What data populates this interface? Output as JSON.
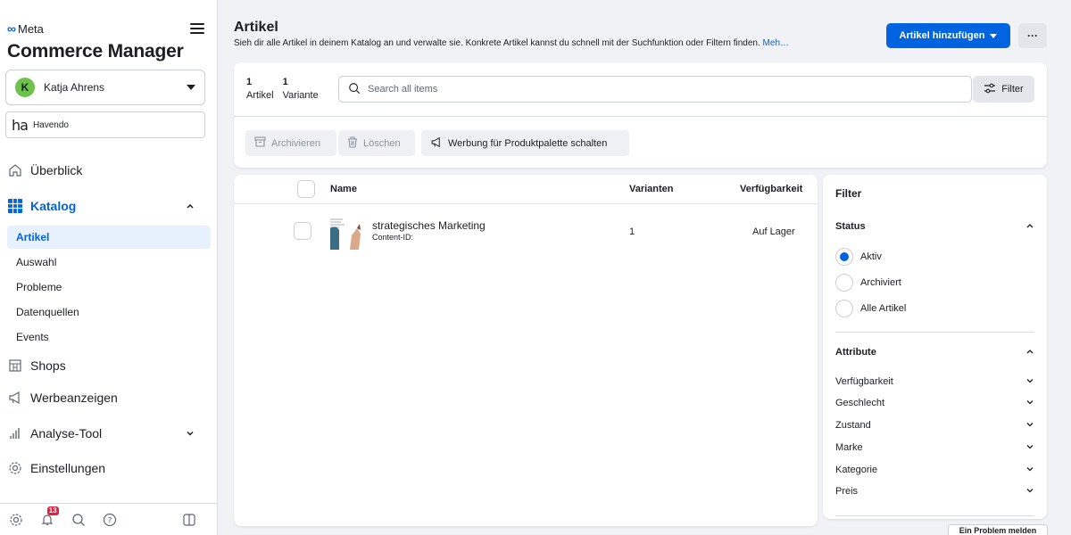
{
  "brand": {
    "meta": "Meta",
    "app_title": "Commerce Manager"
  },
  "account": {
    "initial": "K",
    "name": "Katja Ahrens"
  },
  "catalog": {
    "logo": "ha",
    "name": "Havendo"
  },
  "nav": {
    "overview": "Überblick",
    "catalog": "Katalog",
    "catalog_sub": [
      "Artikel",
      "Auswahl",
      "Probleme",
      "Datenquellen",
      "Events"
    ],
    "shops": "Shops",
    "ads": "Werbeanzeigen",
    "analytics": "Analyse-Tool",
    "settings": "Einstellungen"
  },
  "footer": {
    "notification_count": "13"
  },
  "header": {
    "title": "Artikel",
    "description": "Sieh dir alle Artikel in deinem Katalog an und verwalte sie. Konkrete Artikel kannst du schnell mit der Suchfunktion oder Filtern finden.",
    "more_link": "Meh…",
    "add_button": "Artikel hinzufügen",
    "more_button": "···"
  },
  "toolbar": {
    "items_count": "1",
    "items_label": "Artikel",
    "variants_count": "1",
    "variants_label": "Variante",
    "search_placeholder": "Search all items",
    "filter_button": "Filter",
    "archive_button": "Archivieren",
    "delete_button": "Löschen",
    "advertise_button": "Werbung für Produktpalette schalten"
  },
  "table": {
    "columns": {
      "name": "Name",
      "variants": "Varianten",
      "availability": "Verfügbarkeit"
    },
    "rows": [
      {
        "name": "strategisches Marketing",
        "content_id": "Content-ID:",
        "variants": "1",
        "availability": "Auf Lager"
      }
    ]
  },
  "filter_panel": {
    "title": "Filter",
    "status_title": "Status",
    "status_options": [
      "Aktiv",
      "Archiviert",
      "Alle Artikel"
    ],
    "status_selected": "Aktiv",
    "attributes_title": "Attribute",
    "attributes": [
      "Verfügbarkeit",
      "Geschlecht",
      "Zustand",
      "Marke",
      "Kategorie",
      "Preis"
    ]
  },
  "report_button": "Ein Problem melden",
  "colors": {
    "accent": "#0064e0",
    "badge": "#e41e3f",
    "avatar": "#6cc24a"
  }
}
